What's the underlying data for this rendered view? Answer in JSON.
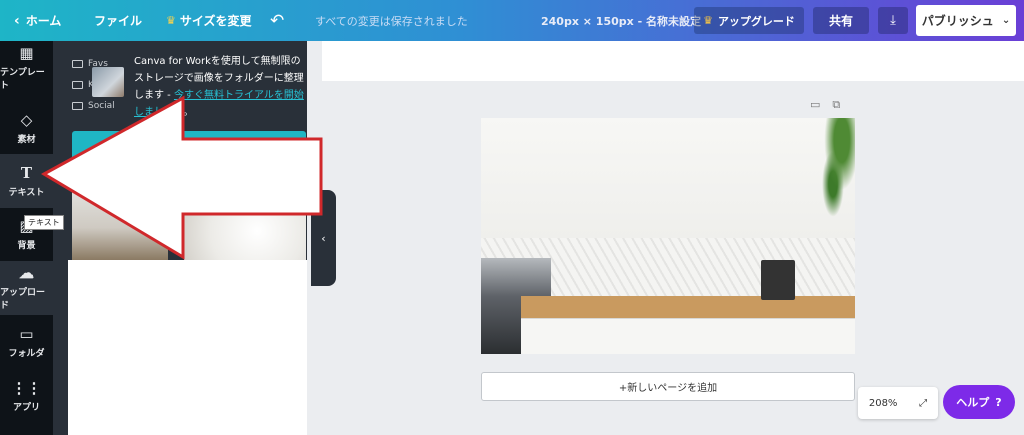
{
  "topbar": {
    "home": "ホーム",
    "file": "ファイル",
    "resize": "サイズを変更",
    "saved_status": "すべての変更は保存されました",
    "dimensions": "240px × 150px - 名称未設定",
    "upgrade": "アップグレード",
    "share": "共有",
    "publish": "パブリッシュ"
  },
  "sidebar": {
    "items": [
      {
        "label": "テンプレート",
        "icon": "template-icon"
      },
      {
        "label": "素材",
        "icon": "shapes-icon"
      },
      {
        "label": "テキスト",
        "icon": "text-icon"
      },
      {
        "label": "背景",
        "icon": "background-icon"
      },
      {
        "label": "アップロード",
        "icon": "upload-icon"
      },
      {
        "label": "フォルダ",
        "icon": "folder-icon"
      },
      {
        "label": "アプリ",
        "icon": "apps-icon"
      }
    ],
    "tooltip": "テキスト"
  },
  "panel": {
    "folders": [
      "Favs",
      "Ka",
      "Social"
    ],
    "promo_text": "Canva for Workを使用して無制限のストレージで画像をフォルダーに整理します - ",
    "promo_link": "今すぐ無料トライアルを開始しましょう",
    "promo_end": "。"
  },
  "canvas": {
    "add_page": "+新しいページを追加"
  },
  "footer": {
    "zoom": "208%",
    "help": "ヘルプ",
    "help_mark": "?"
  },
  "colors": {
    "accent": "#1fb6c4",
    "help": "#7d2ae8",
    "arrow": "#d0282b"
  }
}
